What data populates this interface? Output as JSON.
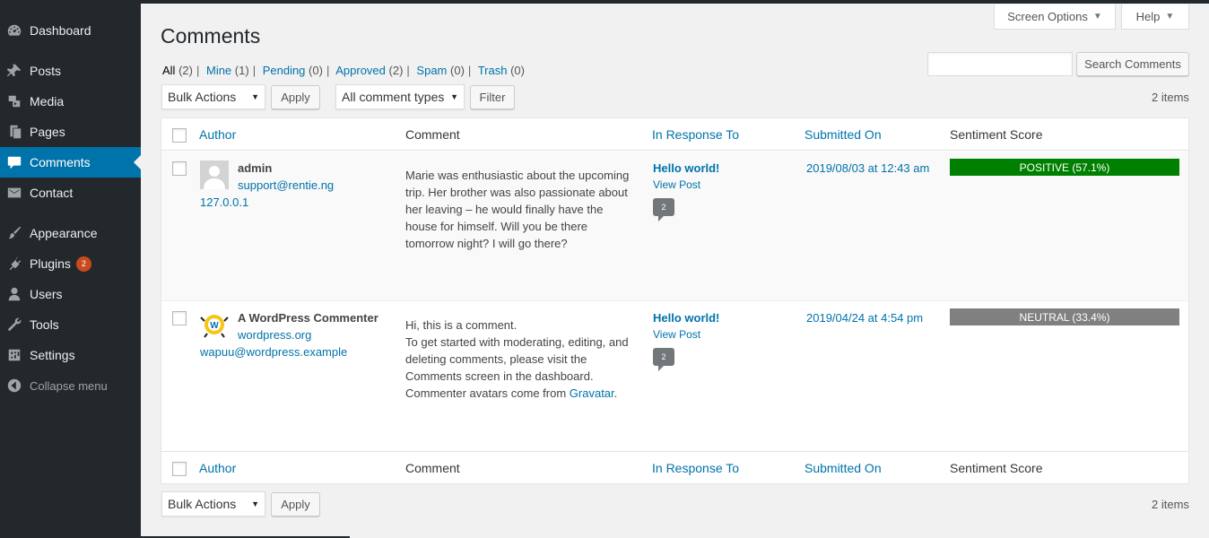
{
  "sidebar": {
    "items": [
      {
        "label": "Dashboard",
        "icon": "dashboard-icon"
      },
      {
        "label": "Posts",
        "icon": "pin-icon"
      },
      {
        "label": "Media",
        "icon": "media-icon"
      },
      {
        "label": "Pages",
        "icon": "pages-icon"
      },
      {
        "label": "Comments",
        "icon": "comment-icon",
        "active": true
      },
      {
        "label": "Contact",
        "icon": "mail-icon"
      },
      {
        "label": "Appearance",
        "icon": "brush-icon"
      },
      {
        "label": "Plugins",
        "icon": "plugin-icon",
        "badge": "2"
      },
      {
        "label": "Users",
        "icon": "user-icon"
      },
      {
        "label": "Tools",
        "icon": "wrench-icon"
      },
      {
        "label": "Settings",
        "icon": "settings-icon"
      }
    ],
    "collapse_label": "Collapse menu"
  },
  "header": {
    "title": "Comments",
    "screen_options": "Screen Options",
    "help": "Help"
  },
  "filters": {
    "all": "All",
    "all_count": "(2)",
    "mine": "Mine",
    "mine_count": "(1)",
    "pending": "Pending",
    "pending_count": "(0)",
    "approved": "Approved",
    "approved_count": "(2)",
    "spam": "Spam",
    "spam_count": "(0)",
    "trash": "Trash",
    "trash_count": "(0)",
    "separator": "|"
  },
  "search": {
    "value": "",
    "button": "Search Comments"
  },
  "toolbar": {
    "bulk_actions": "Bulk Actions",
    "apply": "Apply",
    "comment_types": "All comment types",
    "filter": "Filter",
    "items_count": "2 items"
  },
  "table": {
    "headers": {
      "author": "Author",
      "comment": "Comment",
      "response": "In Response To",
      "submitted": "Submitted On",
      "sentiment": "Sentiment Score"
    },
    "rows": [
      {
        "author_name": "admin",
        "author_email": "support@rentie.ng",
        "author_ip": "127.0.0.1",
        "comment_lines": [
          "Marie was enthusiastic about the upcoming",
          "trip. Her brother was also passionate about",
          "her leaving – he would finally have the",
          "house for himself. Will you be there",
          "tomorrow night? I will go there?"
        ],
        "response_title": "Hello world!",
        "view_post": "View Post",
        "comment_count": "2",
        "submitted": "2019/08/03 at 12:43 am",
        "sentiment_label": "POSITIVE (57.1%)",
        "sentiment_color": "#008000"
      },
      {
        "author_name": "A WordPress Commenter",
        "author_url": "wordpress.org",
        "author_email": "wapuu@wordpress.example",
        "comment_lines": [
          "Hi, this is a comment.",
          "To get started with moderating, editing, and",
          "deleting comments, please visit the",
          "Comments screen in the dashboard.",
          "Commenter avatars come from"
        ],
        "comment_link": "Gravatar",
        "comment_end": ".",
        "response_title": "Hello world!",
        "view_post": "View Post",
        "comment_count": "2",
        "submitted": "2019/04/24 at 4:54 pm",
        "sentiment_label": "NEUTRAL (33.4%)",
        "sentiment_color": "#808080"
      }
    ]
  },
  "colors": {
    "sidebar_bg": "#23282d",
    "accent": "#0073aa",
    "badge": "#ca4a1f"
  }
}
